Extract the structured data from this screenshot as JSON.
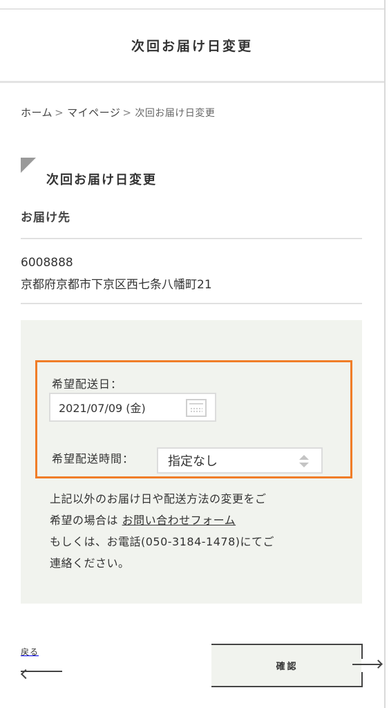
{
  "header": {
    "title": "次回お届け日変更"
  },
  "breadcrumb": {
    "home": "ホーム",
    "separator": ">",
    "mypage": "マイページ",
    "current": "次回お届け日変更"
  },
  "section": {
    "title": "次回お届け日変更"
  },
  "destination": {
    "label": "お届け先",
    "postal_code": "6008888",
    "address": "京都府京都市下京区西七条八幡町21"
  },
  "form": {
    "date_label": "希望配送日：",
    "date_value": "2021/07/09 (金)",
    "date_icon": "calendar-icon",
    "time_label": "希望配送時間：",
    "time_value": "指定なし",
    "time_icon": "select-arrows-icon"
  },
  "note": {
    "line1": "上記以外のお届け日や配送方法の変更をご",
    "line2_prefix": "希望の場合は ",
    "contact_link": "お問い合わせフォーム",
    "line3": "もしくは、お電話(050-3184-1478)にてご",
    "line4": "連絡ください。"
  },
  "footer": {
    "back_label": "戻る",
    "confirm_label": "確認"
  },
  "colors": {
    "accent_border": "#f07d28",
    "panel_background": "#f1f3ee",
    "text": "#333333"
  }
}
